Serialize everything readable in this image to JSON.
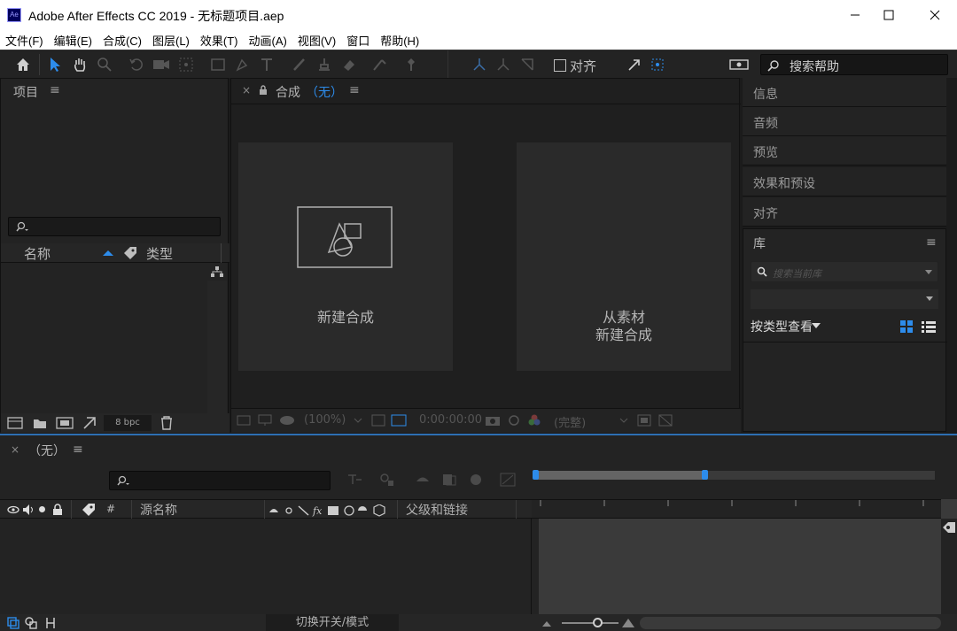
{
  "window": {
    "app_icon": "Ae",
    "title": "Adobe After Effects CC 2019 - 无标题项目.aep",
    "minimize_icon": "minimize-icon",
    "maximize_icon": "maximize-icon",
    "close_icon": "close-icon"
  },
  "menu": [
    "文件(F)",
    "编辑(E)",
    "合成(C)",
    "图层(L)",
    "效果(T)",
    "动画(A)",
    "视图(V)",
    "窗口",
    "帮助(H)"
  ],
  "toolbar": {
    "align_label": "对齐",
    "search_help_label": "搜索帮助"
  },
  "project_panel": {
    "title": "项目",
    "col_name": "名称",
    "col_type": "类型",
    "bpc": "8 bpc"
  },
  "comp_panel": {
    "tab_prefix": "合成",
    "tab_none": "（无）",
    "new_comp": "新建合成",
    "from_footage_line1": "从素材",
    "from_footage_line2": "新建合成",
    "zoom": "(100%)",
    "timecode": "0:00:00:00",
    "resolution": "(完整)"
  },
  "right_panels": {
    "info": "信息",
    "audio": "音频",
    "preview": "预览",
    "effects_presets": "效果和预设",
    "align": "对齐",
    "libraries": "库",
    "search_placeholder": "搜索当前库",
    "view_by_type": "按类型查看"
  },
  "timeline": {
    "tab_none": "（无）",
    "col_hash": "#",
    "col_source_name": "源名称",
    "col_parent": "父级和链接",
    "toggle_modes": "切换开关/模式"
  },
  "colors": {
    "accent_blue": "#2d8ceb",
    "panel_bg": "#232323",
    "titlebar": "#ffffff"
  }
}
